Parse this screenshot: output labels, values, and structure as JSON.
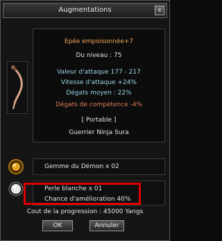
{
  "window": {
    "title": "Augmentations",
    "close_label": "x"
  },
  "item": {
    "name": "Epée empoisonnée+7",
    "level": "Du niveau : 75",
    "attack": "Valeur d'attaque 177 - 217",
    "speed": "Vitesse d'attaque +24%",
    "avg_damage": "Dégats moyen :  22%",
    "skill_damage": "Dégats de compétence -4%",
    "wearable": "[ Portable ]",
    "class": "Guerrier Ninja Sura",
    "icon": "poisoned-sword-icon"
  },
  "materials": [
    {
      "label": "Gemme du Démon x 02",
      "icon": "demon-gem-icon"
    },
    {
      "label": "Perle blanche x 01",
      "icon": "white-pearl-icon"
    }
  ],
  "chance": "Chance d'amélioration 40%",
  "cost": "Cout de la progression : 45000 Yangs",
  "buttons": {
    "ok": "OK",
    "cancel": "Annuler"
  },
  "colors": {
    "item_name": "#f0a65c",
    "stats": "#9ad7e6",
    "skill_penalty": "#e07a5a",
    "highlight": "#e00000"
  }
}
